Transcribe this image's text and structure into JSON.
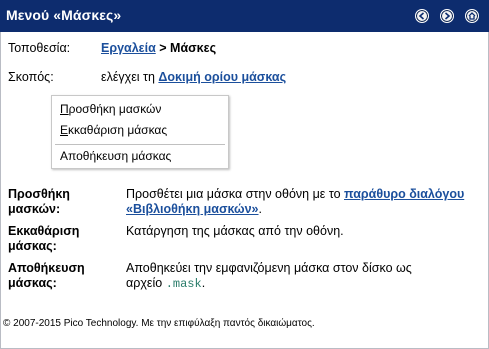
{
  "window": {
    "title": "Μενού «Μάσκες»",
    "buttons": [
      "back-icon",
      "forward-icon",
      "home-icon"
    ],
    "title_bar_color": "#0d2c6e"
  },
  "location": {
    "label": "Τοποθεσία:",
    "link": "Εργαλεία",
    "separator": ">",
    "current": "Μάσκες"
  },
  "purpose": {
    "label": "Σκοπός:",
    "text": "ελέγχει τη",
    "link": "Δοκιμή ορίου μάσκας"
  },
  "menu": {
    "items": [
      {
        "mnemonic": "Π",
        "rest": "ροσθήκη μασκών"
      },
      {
        "mnemonic": "Ε",
        "rest": "κκαθάριση μάσκας"
      },
      {
        "mnemonic": "",
        "rest": "Αποθήκευση μάσκας"
      }
    ]
  },
  "definitions": [
    {
      "term_line1": "Προσθήκη",
      "term_line2": "μασκών:",
      "desc_text": "Προσθέτει μια μάσκα στην οθόνη με το ",
      "desc_link": "παράθυρο διαλόγου «Βιβλιοθήκη μασκών»",
      "desc_end": "."
    },
    {
      "term_line1": "Εκκαθάριση",
      "term_line2": "μάσκας:",
      "desc_text": "Κατάργηση της μάσκας από την οθόνη."
    },
    {
      "term_line1": "Αποθήκευση",
      "term_line2": "μάσκας:",
      "desc_text": "Αποθηκεύει την εμφανιζόμενη μάσκα στον δίσκο ως",
      "desc_text2": "αρχείο ",
      "desc_code": ".mask",
      "desc_end": "."
    }
  ],
  "footer": "© 2007-2015 Pico Technology. Με την επιφύλαξη παντός δικαιώματος.",
  "colors": {
    "link": "#1b4f9c",
    "code": "#2a7c6a"
  }
}
